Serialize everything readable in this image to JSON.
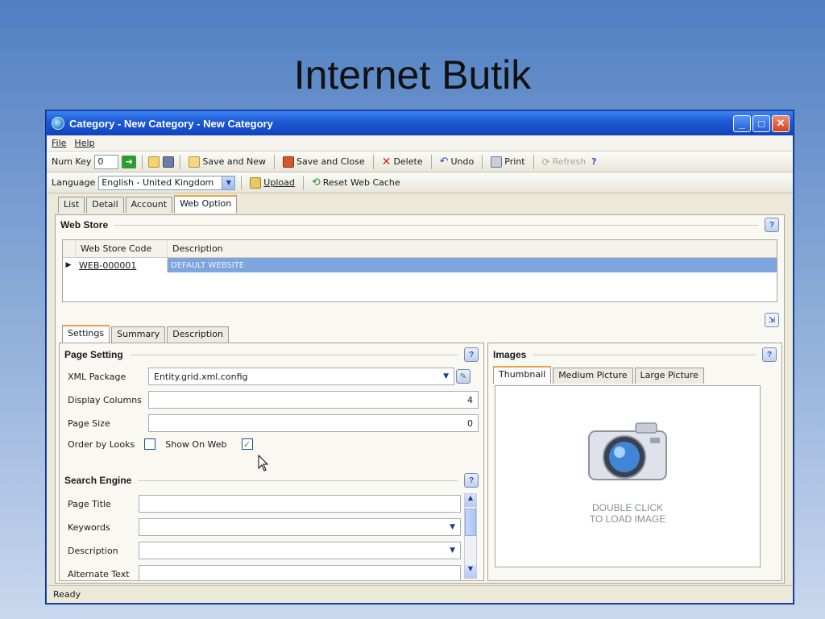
{
  "slide": {
    "title": "Internet Butik"
  },
  "window": {
    "title": "Category - New Category - New Category"
  },
  "menu": {
    "file": "File",
    "help": "Help"
  },
  "toolbar": {
    "numkey_label": "Num Key",
    "numkey_value": "0",
    "save_and_new": "Save and New",
    "save_and_close": "Save and Close",
    "delete": "Delete",
    "undo": "Undo",
    "print": "Print",
    "refresh": "Refresh"
  },
  "toolbar2": {
    "language_label": "Language",
    "language_value": "English - United Kingdom",
    "upload": "Upload",
    "reset_cache": "Reset Web Cache"
  },
  "tabs": [
    "List",
    "Detail",
    "Account",
    "Web Option"
  ],
  "web_store": {
    "title": "Web Store",
    "columns": [
      "Web Store Code",
      "Description"
    ],
    "rows": [
      {
        "code": "WEB-000001",
        "description": "DEFAULT WEBSITE"
      }
    ]
  },
  "subtabs": [
    "Settings",
    "Summary",
    "Description"
  ],
  "page_setting": {
    "title": "Page Setting",
    "xml_label": "XML Package",
    "xml_value": "Entity.grid.xml.config",
    "cols_label": "Display Columns",
    "cols_value": "4",
    "size_label": "Page Size",
    "size_value": "0",
    "order_label": "Order by Looks",
    "show_label": "Show On Web"
  },
  "search_engine": {
    "title": "Search Engine",
    "page_title_label": "Page Title",
    "keywords_label": "Keywords",
    "description_label": "Description",
    "alt_text_label": "Alternate Text"
  },
  "images": {
    "title": "Images",
    "tabs": [
      "Thumbnail",
      "Medium Picture",
      "Large Picture"
    ],
    "placeholder_line1": "DOUBLE CLICK",
    "placeholder_line2": "TO LOAD IMAGE"
  },
  "status": {
    "text": "Ready"
  },
  "colors": {
    "selection": "#7fa5e0",
    "titlebar": "#1f5cd6"
  }
}
